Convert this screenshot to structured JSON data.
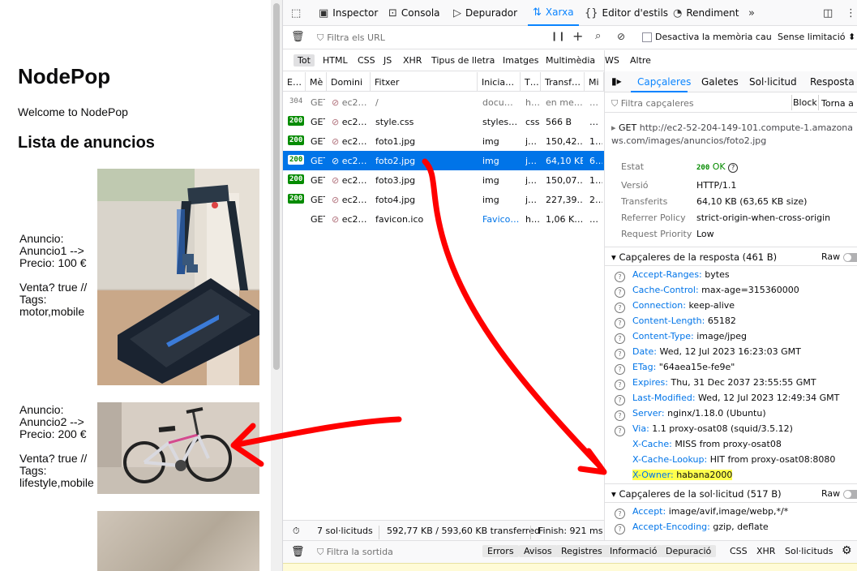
{
  "page": {
    "title": "NodePop",
    "welcome": "Welcome to NodePop",
    "list_title": "Lista de anuncios",
    "ads": [
      {
        "line1": "Anuncio:",
        "line2": "Anuncio1 -->",
        "line3": "Precio: 100 €",
        "line4": "Venta? true //",
        "line5": "Tags:",
        "line6": "motor,mobile"
      },
      {
        "line1": "Anuncio:",
        "line2": "Anuncio2 -->",
        "line3": "Precio: 200 €",
        "line4": "Venta? true //",
        "line5": "Tags:",
        "line6": "lifestyle,mobile"
      }
    ]
  },
  "toolbox": {
    "pick_icon": "element-picker-icon",
    "tools": [
      {
        "label": "Inspector",
        "icon": "inspector-icon"
      },
      {
        "label": "Consola",
        "icon": "console-icon"
      },
      {
        "label": "Depurador",
        "icon": "debugger-icon"
      },
      {
        "label": "Xarxa",
        "icon": "network-icon"
      },
      {
        "label": "Editor d'estils",
        "icon": "style-editor-icon"
      },
      {
        "label": "Rendiment",
        "icon": "performance-icon"
      }
    ],
    "overflow_icon": "double-chevron-icon",
    "dock_icon": "dock-icon",
    "more_icon": "kebab-menu-icon"
  },
  "filterbar": {
    "placeholder": "Filtra els URL",
    "disable_cache": "Desactiva la memòria cau",
    "throttle": "Sense limitació ⬍"
  },
  "types": [
    "Tot",
    "HTML",
    "CSS",
    "JS",
    "XHR",
    "Tipus de lletra",
    "Imatges",
    "Multimèdia",
    "WS",
    "Altre"
  ],
  "columns": [
    "E…",
    "Mè",
    "Domini",
    "Fitxer",
    "Inicia…",
    "T…",
    "Transf…",
    "Mi"
  ],
  "requests": [
    {
      "status": "304",
      "method": "GET",
      "domain": "ec2…",
      "file": "/",
      "initiator": "docu…",
      "type": "h…",
      "transfer": "en me…",
      "size": "…"
    },
    {
      "status": "200",
      "method": "GET",
      "domain": "ec2…",
      "file": "style.css",
      "initiator": "styles…",
      "type": "css",
      "transfer": "566 B",
      "size": "…"
    },
    {
      "status": "200",
      "method": "GET",
      "domain": "ec2…",
      "file": "foto1.jpg",
      "initiator": "img",
      "type": "j…",
      "transfer": "150,42…",
      "size": "1…"
    },
    {
      "status": "200",
      "method": "GET",
      "domain": "ec2…",
      "file": "foto2.jpg",
      "initiator": "img",
      "type": "j…",
      "transfer": "64,10 KB",
      "size": "6…"
    },
    {
      "status": "200",
      "method": "GET",
      "domain": "ec2…",
      "file": "foto3.jpg",
      "initiator": "img",
      "type": "j…",
      "transfer": "150,07…",
      "size": "1…"
    },
    {
      "status": "200",
      "method": "GET",
      "domain": "ec2…",
      "file": "foto4.jpg",
      "initiator": "img",
      "type": "j…",
      "transfer": "227,39…",
      "size": "2…"
    },
    {
      "status": "",
      "method": "GET",
      "domain": "ec2…",
      "file": "favicon.ico",
      "initiator": "Favico…",
      "type": "h…",
      "transfer": "1,06 K…",
      "size": "…"
    }
  ],
  "summary": {
    "requests": "7 sol·licituds",
    "transferred": "592,77 KB / 593,60 KB transferred",
    "finish": "Finish: 921 ms"
  },
  "details": {
    "tabs": [
      "Capçaleres",
      "Galetes",
      "Sol·licitud",
      "Resposta"
    ],
    "filter_placeholder": "Filtra capçaleres",
    "block_label": "Block",
    "resend_label": "Torna a e",
    "method": "GET",
    "url": "http://ec2-52-204-149-101.compute-1.amazonaws.com/images/anuncios/foto2.jpg",
    "status_label": "Estat",
    "status_code": "200",
    "status_text": "OK",
    "version_label": "Versió",
    "version": "HTTP/1.1",
    "transferred_label": "Transferits",
    "transferred": "64,10 KB (63,65 KB size)",
    "referrer_label": "Referrer Policy",
    "referrer": "strict-origin-when-cross-origin",
    "priority_label": "Request Priority",
    "priority": "Low",
    "response_headers_title": "Capçaleres de la resposta (461 B)",
    "request_headers_title": "Capçaleres de la sol·licitud (517 B)",
    "raw_label": "Raw",
    "response_headers": [
      {
        "name": "Accept-Ranges:",
        "value": "bytes",
        "help": true
      },
      {
        "name": "Cache-Control:",
        "value": "max-age=315360000",
        "help": true
      },
      {
        "name": "Connection:",
        "value": "keep-alive",
        "help": true
      },
      {
        "name": "Content-Length:",
        "value": "65182",
        "help": true
      },
      {
        "name": "Content-Type:",
        "value": "image/jpeg",
        "help": true
      },
      {
        "name": "Date:",
        "value": "Wed, 12 Jul 2023 16:23:03 GMT",
        "help": true
      },
      {
        "name": "ETag:",
        "value": "\"64aea15e-fe9e\"",
        "help": true
      },
      {
        "name": "Expires:",
        "value": "Thu, 31 Dec 2037 23:55:55 GMT",
        "help": true
      },
      {
        "name": "Last-Modified:",
        "value": "Wed, 12 Jul 2023 12:49:34 GMT",
        "help": true
      },
      {
        "name": "Server:",
        "value": "nginx/1.18.0 (Ubuntu)",
        "help": true
      },
      {
        "name": "Via:",
        "value": "1.1 proxy-osat08 (squid/3.5.12)",
        "help": true
      },
      {
        "name": "X-Cache:",
        "value": "MISS from proxy-osat08",
        "help": false
      },
      {
        "name": "X-Cache-Lookup:",
        "value": "HIT from proxy-osat08:8080",
        "help": false
      },
      {
        "name": "X-Owner:",
        "value": "habana2000",
        "help": false
      }
    ],
    "request_headers": [
      {
        "name": "Accept:",
        "value": "image/avif,image/webp,*/*"
      },
      {
        "name": "Accept-Encoding:",
        "value": "gzip, deflate"
      }
    ]
  },
  "console": {
    "placeholder": "Filtra la sortida",
    "levels": [
      "Errors",
      "Avisos",
      "Registres",
      "Informació",
      "Depuració"
    ],
    "extras": [
      "CSS",
      "XHR",
      "Sol·licituds"
    ]
  },
  "colors": {
    "accent": "#0a84ff",
    "selected_row": "#0074e8",
    "ok_green": "#058b00",
    "annotation_red": "#ff0000",
    "highlight_yellow": "#ffff4d"
  }
}
